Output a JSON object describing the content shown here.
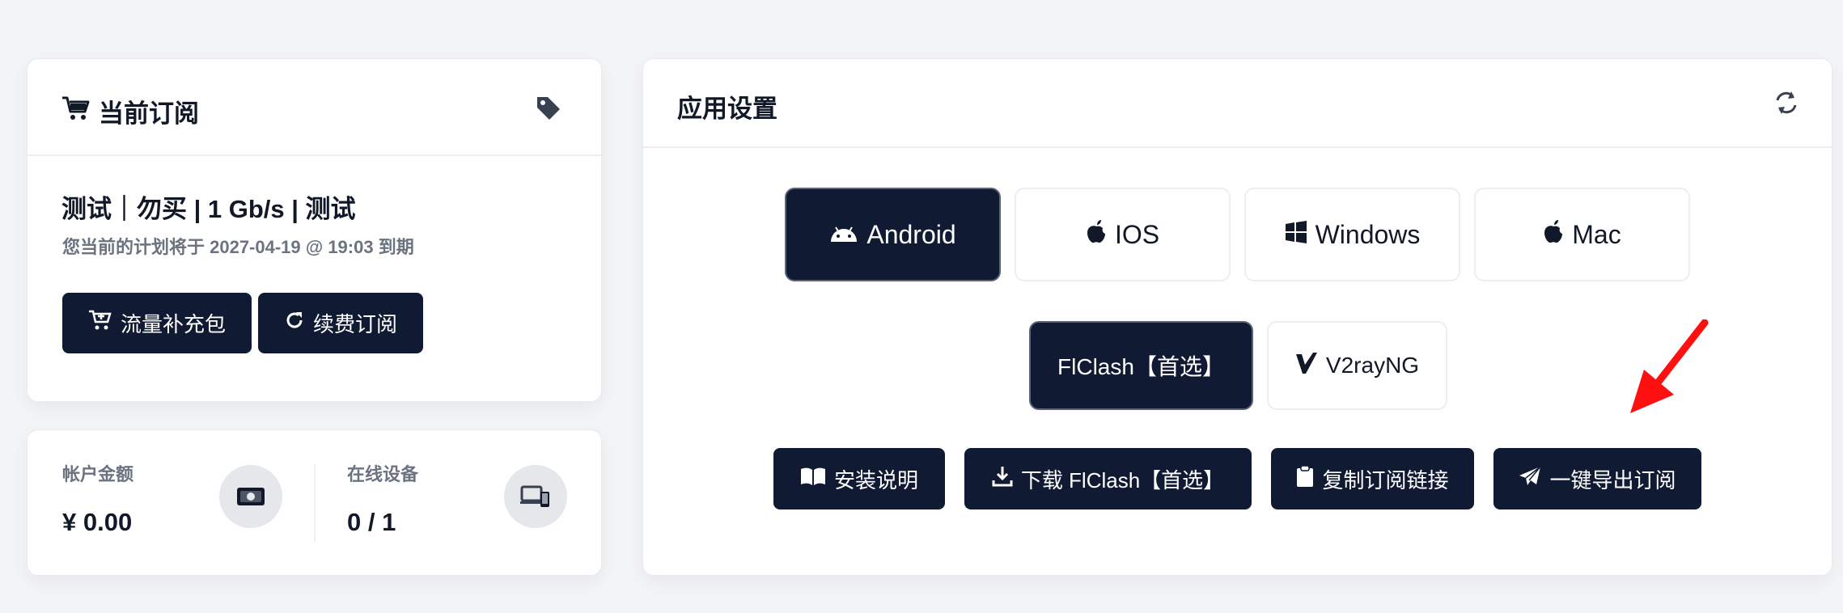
{
  "subscription": {
    "title": "当前订阅",
    "plan_name": "测试｜勿买 | 1 Gb/s | 测试",
    "expiry": "您当前的计划将于 2027-04-19 @ 19:03 到期",
    "topup_label": "流量补充包",
    "renew_label": "续费订阅"
  },
  "stats": {
    "balance_label": "帐户金额",
    "balance_value": "¥ 0.00",
    "devices_label": "在线设备",
    "devices_value": "0 / 1"
  },
  "app_settings": {
    "title": "应用设置",
    "os_tabs": [
      {
        "label": "Android",
        "icon": "android-icon"
      },
      {
        "label": "IOS",
        "icon": "apple-icon"
      },
      {
        "label": "Windows",
        "icon": "windows-icon"
      },
      {
        "label": "Mac",
        "icon": "apple-icon"
      }
    ],
    "client_tabs": [
      {
        "label": "FlClash【首选】"
      },
      {
        "label": "V2rayNG",
        "icon": "v2ray-icon"
      }
    ],
    "actions": [
      {
        "label": "安装说明",
        "icon": "book-icon"
      },
      {
        "label": "下载 FlClash【首选】",
        "icon": "download-icon"
      },
      {
        "label": "复制订阅链接",
        "icon": "clipboard-icon"
      },
      {
        "label": "一键导出订阅",
        "icon": "paper-plane-icon"
      }
    ]
  },
  "colors": {
    "primary_dark": "#111a33",
    "background": "#f3f4f6",
    "muted_text": "#6b7280",
    "annotation_arrow": "#ff1010"
  }
}
